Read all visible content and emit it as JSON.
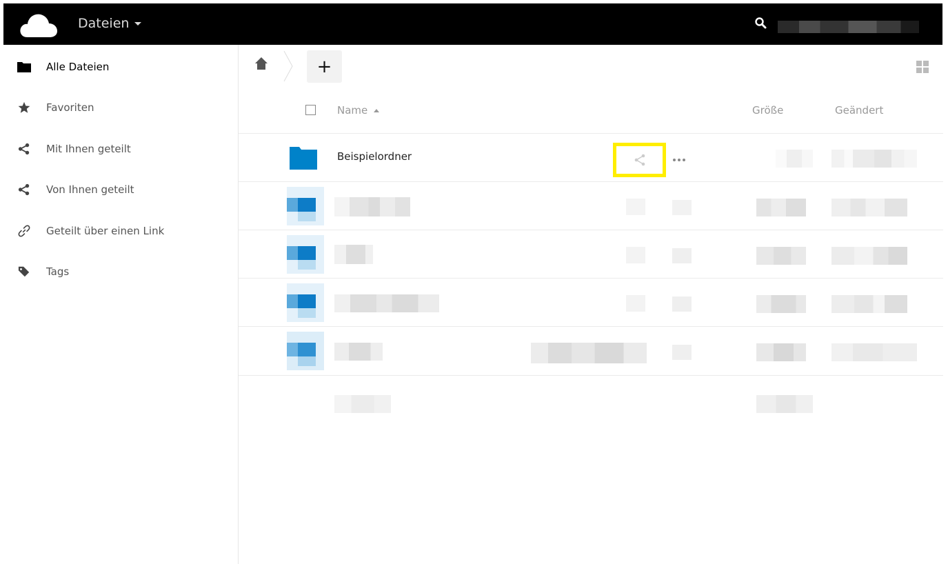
{
  "header": {
    "app_name": "Dateien",
    "logo_icon": "cloud-icon",
    "search_icon": "search-icon"
  },
  "sidebar": {
    "items": [
      {
        "label": "Alle Dateien",
        "icon": "folder-icon",
        "active": true
      },
      {
        "label": "Favoriten",
        "icon": "star-icon",
        "active": false
      },
      {
        "label": "Mit Ihnen geteilt",
        "icon": "share-icon",
        "active": false
      },
      {
        "label": "Von Ihnen geteilt",
        "icon": "share-icon",
        "active": false
      },
      {
        "label": "Geteilt über einen Link",
        "icon": "link-icon",
        "active": false
      },
      {
        "label": "Tags",
        "icon": "tag-icon",
        "active": false
      }
    ]
  },
  "controls": {
    "add_label": "+",
    "home_icon": "home-icon",
    "view_toggle_icon": "grid-view-icon"
  },
  "table": {
    "columns": {
      "name": "Name",
      "size": "Größe",
      "modified": "Geändert"
    },
    "rows": [
      {
        "name": "Beispielordner",
        "type": "folder",
        "share_icon": "share-icon",
        "more_icon": "more-icon"
      }
    ]
  },
  "colors": {
    "header_bg": "#000000",
    "folder_blue": "#0082c9",
    "highlight": "#ffee00"
  }
}
